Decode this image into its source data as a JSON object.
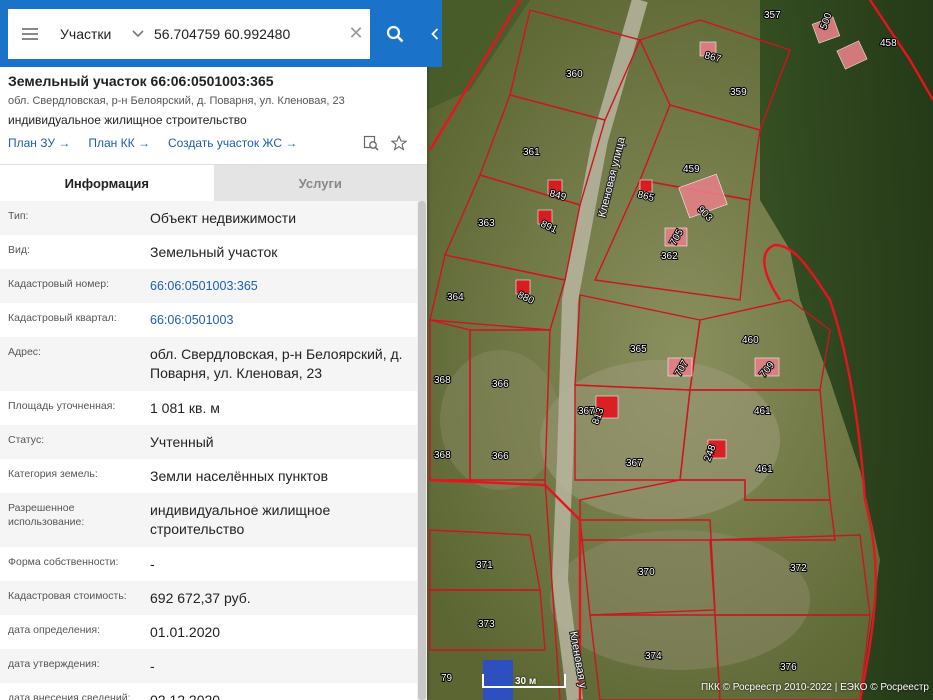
{
  "search": {
    "layer": "Участки",
    "query": "56.704759 60.992480",
    "clear_glyph": "✕"
  },
  "object": {
    "title": "Земельный участок 66:06:0501003:365",
    "address": "обл. Свердловская, р-н Белоярский, д. Поварня, ул. Кленовая, 23",
    "usage": "индивидуальное жилищное строительство",
    "actions": [
      "План ЗУ",
      "План КК",
      "Создать участок ЖС"
    ]
  },
  "tabs": [
    "Информация",
    "Услуги"
  ],
  "info": [
    {
      "key": "Тип:",
      "value": "Объект недвижимости"
    },
    {
      "key": "Вид:",
      "value": "Земельный участок"
    },
    {
      "key": "Кадастровый номер:",
      "value": "66:06:0501003:365"
    },
    {
      "key": "Кадастровый квартал:",
      "value": "66:06:0501003"
    },
    {
      "key": "Адрес:",
      "value": "обл. Свердловская, р-н Белоярский, д. Поварня, ул. Кленовая, 23"
    },
    {
      "key": "Площадь уточненная:",
      "value": "1 081 кв. м"
    },
    {
      "key": "Статус:",
      "value": "Учтенный"
    },
    {
      "key": "Категория земель:",
      "value": "Земли населённых пунктов"
    },
    {
      "key": "Разрешенное использование:",
      "value": "индивидуальное жилищное строительство"
    },
    {
      "key": "Форма собственности:",
      "value": "-"
    },
    {
      "key": "Кадастровая стоимость:",
      "value": "692 672,37 руб."
    },
    {
      "key": "дата определения:",
      "value": "01.01.2020"
    },
    {
      "key": "дата утверждения:",
      "value": "-"
    },
    {
      "key": "дата внесения сведений:",
      "value": "02.12.2020"
    }
  ],
  "map": {
    "plot_labels": [
      "357",
      "500",
      "458",
      "360",
      "359",
      "361",
      "459",
      "363",
      "362",
      "364",
      "460",
      "365",
      "368",
      "366",
      "367",
      "461",
      "368",
      "366",
      "367",
      "461",
      "371",
      "370",
      "372",
      "373",
      "374",
      "376",
      "79"
    ],
    "building_labels": [
      "867",
      "849",
      "865",
      "903",
      "891",
      "705",
      "880",
      "707",
      "709",
      "813",
      "248"
    ],
    "streets": [
      "Кленовая улица",
      "Кленовая у"
    ],
    "scale": "30 м",
    "copyright": "ПКК © Росреестр 2010-2022 | ЕЭКО © Росреестр"
  },
  "colors": {
    "accent": "#1a73c8",
    "link": "#1a5fb4",
    "boundary": "#d0141f"
  }
}
